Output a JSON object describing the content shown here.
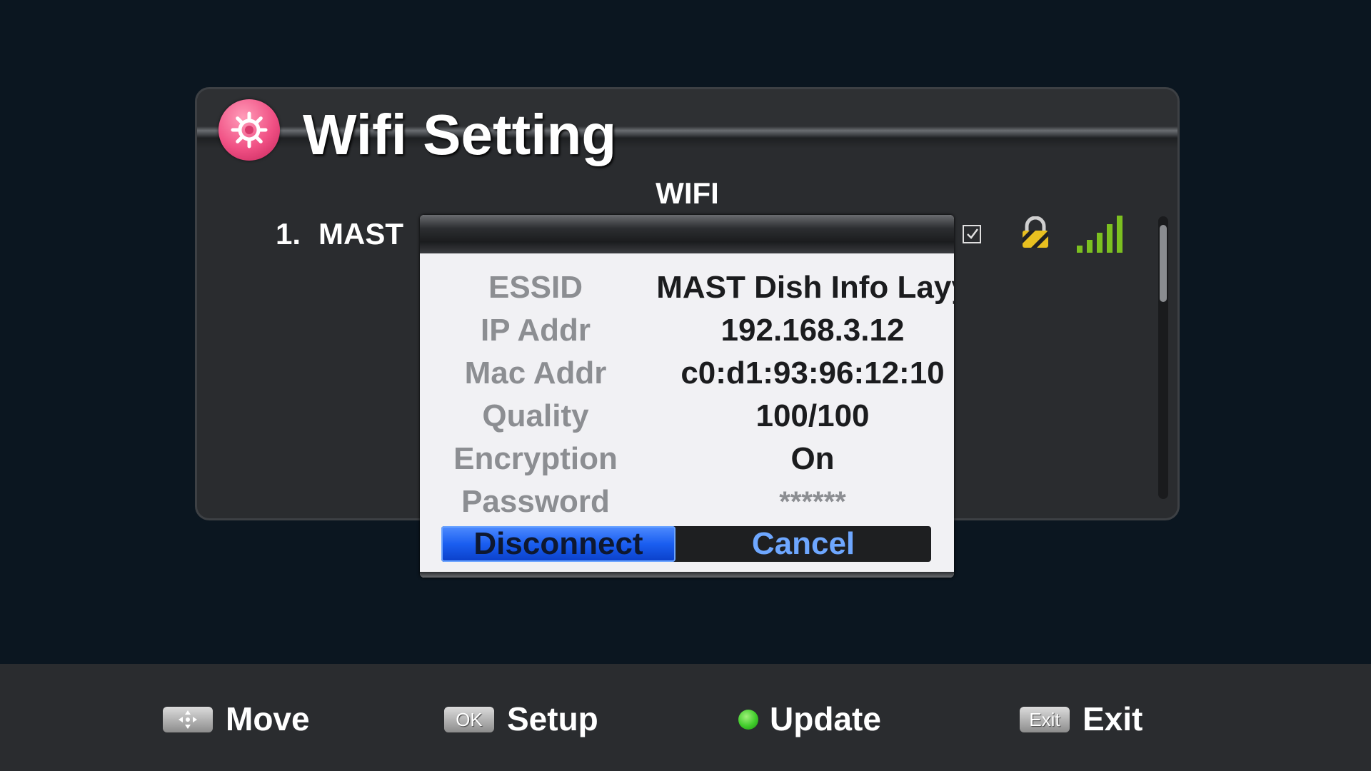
{
  "window": {
    "title": "Wifi Setting"
  },
  "list": {
    "header": "WIFI",
    "rows": [
      {
        "number": "1.",
        "name": "MAST",
        "checked": true,
        "locked": true,
        "signal": "full"
      }
    ]
  },
  "dialog": {
    "fields": [
      {
        "label": "ESSID",
        "value": "MAST Dish Info Layy"
      },
      {
        "label": "IP Addr",
        "value": "192.168.3.12"
      },
      {
        "label": "Mac Addr",
        "value": "c0:d1:93:96:12:10"
      },
      {
        "label": "Quality",
        "value": "100/100"
      },
      {
        "label": "Encryption",
        "value": "On"
      },
      {
        "label": "Password",
        "value": "******"
      }
    ],
    "buttons": {
      "disconnect": "Disconnect",
      "cancel": "Cancel"
    },
    "selected_button": "disconnect"
  },
  "footer": {
    "hints": [
      {
        "key": "",
        "key_icon": "dpad-icon",
        "label": "Move"
      },
      {
        "key": "OK",
        "label": "Setup"
      },
      {
        "key_icon": "green-button-icon",
        "label": "Update"
      },
      {
        "key": "Exit",
        "label": "Exit"
      }
    ]
  },
  "colors": {
    "accent_blue": "#1a5ef0",
    "cancel_text": "#6ea7ff",
    "update_green": "#3fcc2a",
    "gear_pink": "#f05084"
  }
}
